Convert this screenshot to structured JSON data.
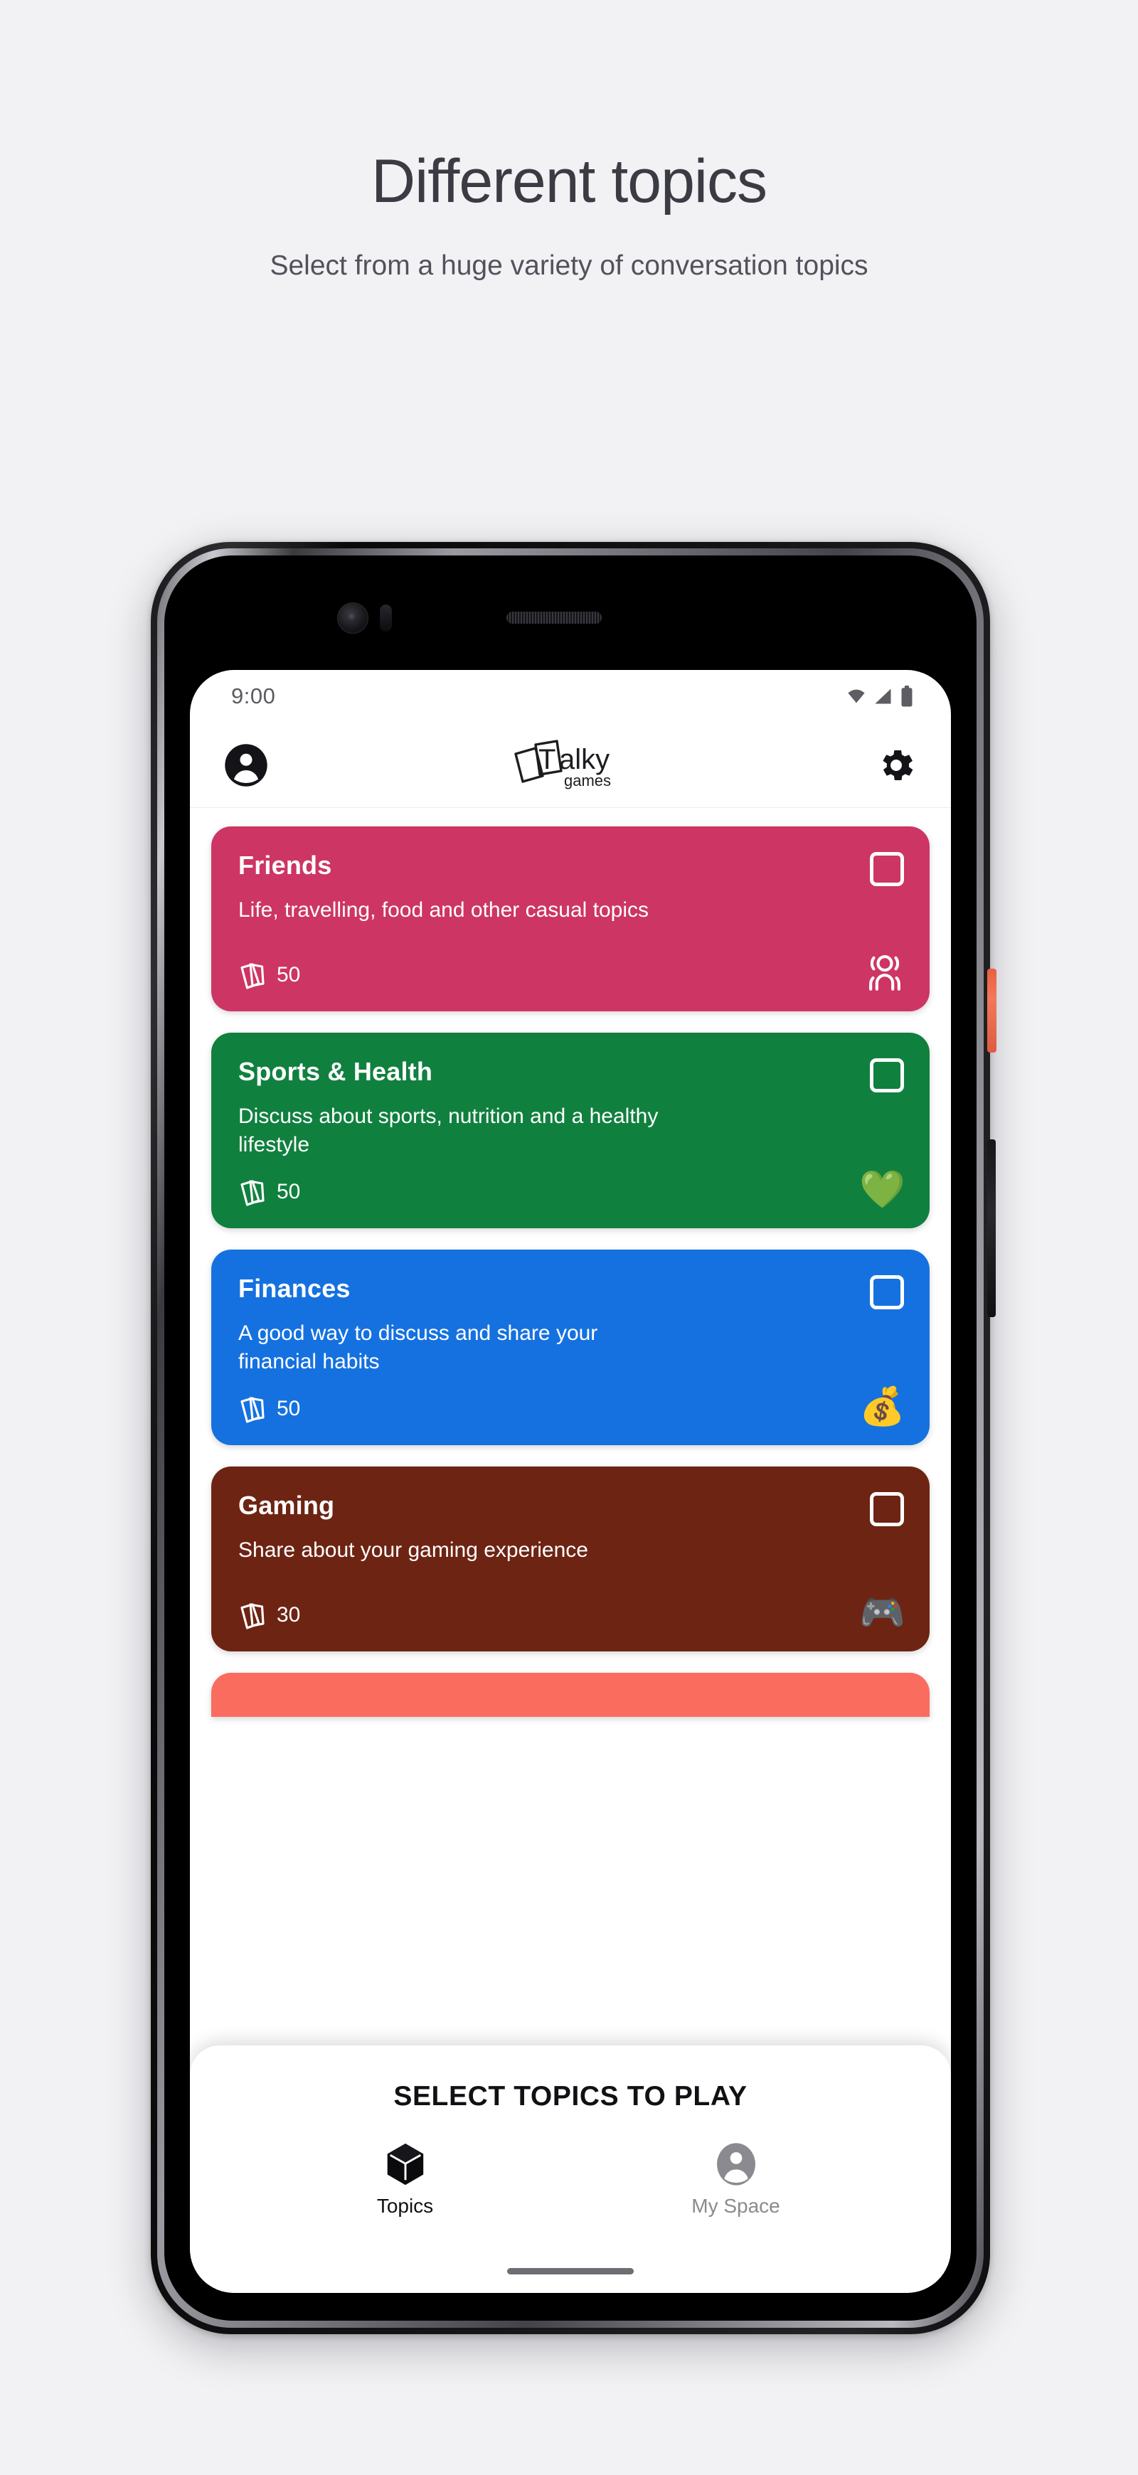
{
  "promo": {
    "title": "Different topics",
    "subtitle": "Select from a huge variety of conversation topics"
  },
  "status_bar": {
    "time": "9:00",
    "icons": [
      "wifi-icon",
      "cellular-signal-icon",
      "battery-icon"
    ]
  },
  "app_bar": {
    "profile_icon": "account-circle-icon",
    "brand_primary": "Talky",
    "brand_secondary": "games",
    "brand_letter": "T",
    "settings_icon": "gear-icon"
  },
  "topics": [
    {
      "title": "Friends",
      "description": "Life, travelling, food and other casual topics",
      "count": "50",
      "color": "#cd3564",
      "emoji": "",
      "icon_name": "people-group-icon",
      "selected": false
    },
    {
      "title": "Sports & Health",
      "description": "Discuss about sports, nutrition and a healthy lifestyle",
      "count": "50",
      "color": "#10803f",
      "emoji": "💚",
      "icon_name": "heartbeat-icon",
      "selected": false
    },
    {
      "title": "Finances",
      "description": "A good way to discuss and share your financial habits",
      "count": "50",
      "color": "#1571e0",
      "emoji": "💰",
      "icon_name": "money-bag-icon",
      "selected": false
    },
    {
      "title": "Gaming",
      "description": "Share about your gaming experience",
      "count": "30",
      "color": "#6e2413",
      "emoji": "🎮",
      "icon_name": "game-controller-icon",
      "selected": false
    }
  ],
  "peek_card": {
    "color": "#fa6c5e"
  },
  "bottom_sheet": {
    "cta_label": "SELECT TOPICS TO PLAY",
    "nav": [
      {
        "label": "Topics",
        "icon_name": "cube-icon",
        "active": true
      },
      {
        "label": "My Space",
        "icon_name": "account-circle-icon",
        "active": false
      }
    ]
  },
  "device": {
    "power_button_color": "#ea6243",
    "volume_button_color": "#1b1b1e"
  }
}
